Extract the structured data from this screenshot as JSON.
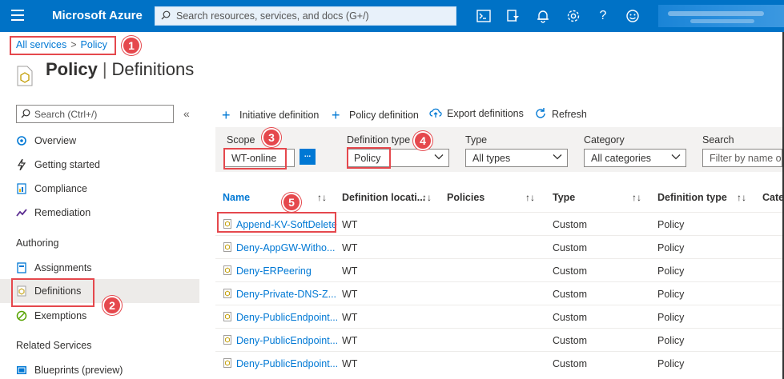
{
  "topbar": {
    "brand": "Microsoft Azure",
    "search_placeholder": "Search resources, services, and docs (G+/)",
    "icons": [
      "cloud-shell-icon",
      "directory-filter-icon",
      "notifications-icon",
      "settings-icon",
      "help-icon",
      "feedback-icon"
    ]
  },
  "breadcrumb": {
    "root": "All services",
    "separator": ">",
    "current": "Policy"
  },
  "page": {
    "title_bold": "Policy",
    "separator": "|",
    "title": "Definitions"
  },
  "sidebar": {
    "search_placeholder": "Search (Ctrl+/)",
    "collapse": "«",
    "items": [
      {
        "label": "Overview",
        "icon": "overview-icon"
      },
      {
        "label": "Getting started",
        "icon": "lightning-icon"
      },
      {
        "label": "Compliance",
        "icon": "compliance-icon"
      },
      {
        "label": "Remediation",
        "icon": "remediation-icon"
      }
    ],
    "section_authoring": "Authoring",
    "authoring_items": [
      {
        "label": "Assignments",
        "icon": "assignments-icon"
      },
      {
        "label": "Definitions",
        "icon": "definitions-icon"
      },
      {
        "label": "Exemptions",
        "icon": "exemptions-icon"
      }
    ],
    "section_related": "Related Services",
    "related_items": [
      {
        "label": "Blueprints (preview)",
        "icon": "blueprints-icon"
      }
    ]
  },
  "toolbar": {
    "initiative": "Initiative definition",
    "policy": "Policy definition",
    "export": "Export definitions",
    "refresh": "Refresh"
  },
  "filters": {
    "scope_label": "Scope",
    "scope_value": "WT-online",
    "scope_button": "...",
    "deftype_label": "Definition type",
    "deftype_value": "Policy",
    "type_label": "Type",
    "type_value": "All types",
    "category_label": "Category",
    "category_value": "All categories",
    "search_label": "Search",
    "search_placeholder": "Filter by name or"
  },
  "table": {
    "headers": [
      "Name",
      "Definition locati...",
      "Policies",
      "Type",
      "Definition type",
      "Cate"
    ],
    "rows": [
      [
        "Append-KV-SoftDelete",
        "WT",
        "",
        "Custom",
        "Policy"
      ],
      [
        "Deny-AppGW-Witho...",
        "WT",
        "",
        "Custom",
        "Policy"
      ],
      [
        "Deny-ERPeering",
        "WT",
        "",
        "Custom",
        "Policy"
      ],
      [
        "Deny-Private-DNS-Z...",
        "WT",
        "",
        "Custom",
        "Policy"
      ],
      [
        "Deny-PublicEndpoint...",
        "WT",
        "",
        "Custom",
        "Policy"
      ],
      [
        "Deny-PublicEndpoint...",
        "WT",
        "",
        "Custom",
        "Policy"
      ],
      [
        "Deny-PublicEndpoint...",
        "WT",
        "",
        "Custom",
        "Policy"
      ]
    ]
  },
  "callouts": [
    "1",
    "2",
    "3",
    "4",
    "5"
  ],
  "colors": {
    "azure_blue": "#0072c6",
    "link": "#0078d4",
    "callout_red": "#e5484d"
  }
}
